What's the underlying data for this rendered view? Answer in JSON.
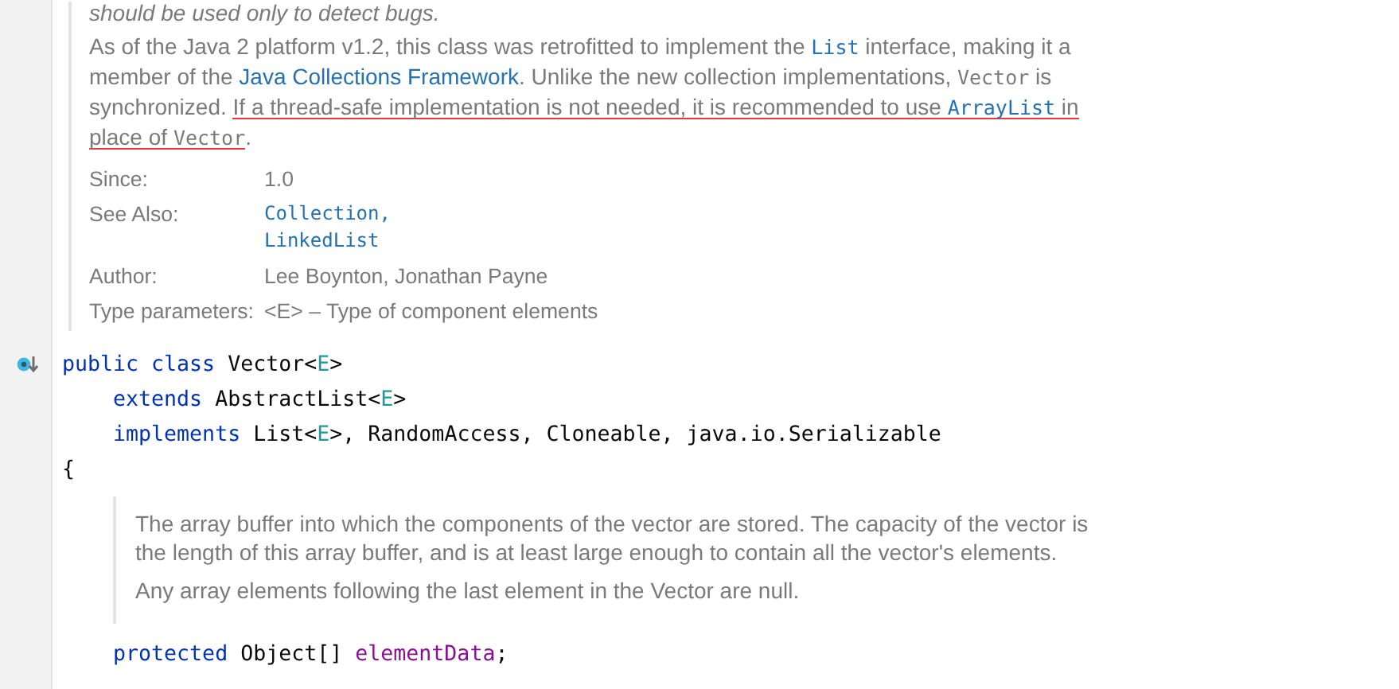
{
  "doc_top": {
    "cut_line": "should be used only to detect bugs.",
    "paragraph": [
      {
        "kind": "text",
        "text": "As of the Java 2 platform v1.2, this class was retrofitted to implement the "
      },
      {
        "kind": "code-link",
        "text": "List"
      },
      {
        "kind": "text",
        "text": " interface, making it a member of the "
      },
      {
        "kind": "link",
        "text": "Java Collections Framework"
      },
      {
        "kind": "text",
        "text": ". Unlike the new collection implementations, "
      },
      {
        "kind": "code",
        "text": "Vector"
      },
      {
        "kind": "text",
        "text": " is synchronized. "
      },
      {
        "kind": "text",
        "text": "If a thread-safe implementation is not needed, it is recommended to use ",
        "annotated": true
      },
      {
        "kind": "code-link",
        "text": "ArrayList",
        "annotated": true
      },
      {
        "kind": "text",
        "text": " in place of ",
        "annotated": true
      },
      {
        "kind": "code",
        "text": "Vector",
        "annotated": true
      },
      {
        "kind": "text",
        "text": "."
      }
    ],
    "tags": [
      {
        "label": "Since:",
        "values": [
          {
            "kind": "text",
            "text": "1.0"
          }
        ]
      },
      {
        "label": "See Also:",
        "values": [
          {
            "kind": "code-link",
            "text": "Collection,"
          },
          {
            "kind": "code-link",
            "text": "LinkedList"
          }
        ]
      },
      {
        "label": "Author:",
        "values": [
          {
            "kind": "text",
            "text": "Lee Boynton, Jonathan Payne"
          }
        ]
      },
      {
        "label": "Type parameters:",
        "values": [
          {
            "kind": "text",
            "text": "<E> – Type of component elements"
          }
        ]
      }
    ]
  },
  "code_top": [
    {
      "gutter_icon": true,
      "tokens": [
        {
          "kind": "keyword",
          "text": "public class "
        },
        {
          "kind": "plain",
          "text": "Vector<"
        },
        {
          "kind": "param",
          "text": "E"
        },
        {
          "kind": "plain",
          "text": ">"
        }
      ]
    },
    {
      "tokens": [
        {
          "kind": "keyword",
          "text": "    extends "
        },
        {
          "kind": "plain",
          "text": "AbstractList<"
        },
        {
          "kind": "param",
          "text": "E"
        },
        {
          "kind": "plain",
          "text": ">"
        }
      ]
    },
    {
      "tokens": [
        {
          "kind": "keyword",
          "text": "    implements "
        },
        {
          "kind": "plain",
          "text": "List<"
        },
        {
          "kind": "param",
          "text": "E"
        },
        {
          "kind": "plain",
          "text": ">, RandomAccess, Cloneable, java.io.Serializable"
        }
      ]
    },
    {
      "tokens": [
        {
          "kind": "plain",
          "text": "{"
        }
      ]
    }
  ],
  "doc_field": {
    "paragraphs": [
      "The array buffer into which the components of the vector are stored. The capacity of the vector is the length of this array buffer, and is at least large enough to contain all the vector's elements.",
      "Any array elements following the last element in the Vector are null."
    ]
  },
  "code_bottom": [
    {
      "tokens": [
        {
          "kind": "keyword",
          "text": "    protected "
        },
        {
          "kind": "plain",
          "text": "Object[] "
        },
        {
          "kind": "field",
          "text": "elementData"
        },
        {
          "kind": "plain",
          "text": ";"
        }
      ]
    }
  ]
}
